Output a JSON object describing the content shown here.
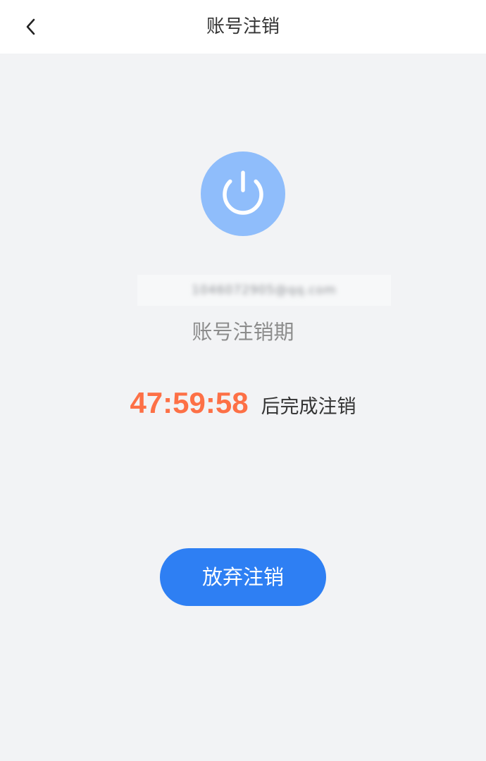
{
  "header": {
    "title": "账号注销",
    "back_icon": "chevron-left-icon"
  },
  "status": {
    "icon": "power-icon",
    "icon_color": "#8fbdfb",
    "account": "1046072905@qq.com",
    "label": "账号注销期"
  },
  "countdown": {
    "time": "47:59:58",
    "suffix": "后完成注销",
    "color": "#fd7046"
  },
  "actions": {
    "abandon_label": "放弃注销",
    "button_color": "#2e7ff3"
  }
}
